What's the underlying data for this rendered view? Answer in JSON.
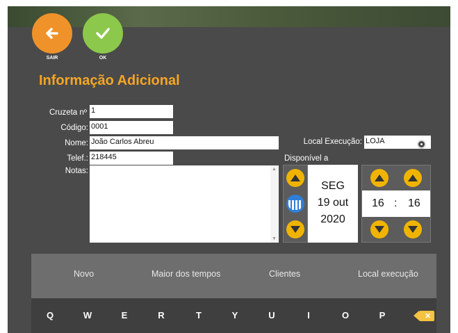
{
  "header": {
    "exit_label": "SAIR",
    "ok_label": "OK",
    "title": "Informação Adicional"
  },
  "form": {
    "cruzeta_label": "Cruzeta nº",
    "cruzeta_value": "1",
    "codigo_label": "Código:",
    "codigo_value": "0001",
    "nome_label": "Nome:",
    "nome_value": "João Carlos Abreu",
    "telef_label": "Telef.:",
    "telef_value": "218445",
    "notas_label": "Notas:",
    "notas_value": "",
    "local_label": "Local Execução:",
    "local_value": "LOJA"
  },
  "availability": {
    "label": "Disponível a",
    "weekday": "SEG",
    "day_month": "19 out",
    "year": "2020",
    "hour": "16",
    "separator": ":",
    "minute": "16"
  },
  "tabs": [
    "Novo",
    "Maior dos tempos",
    "Clientes",
    "Local execução"
  ],
  "keyboard": [
    "Q",
    "W",
    "E",
    "R",
    "T",
    "Y",
    "U",
    "I",
    "O",
    "P"
  ],
  "icons": {
    "exit": "arrow-left-icon",
    "ok": "checkmark-icon",
    "search": "search-icon",
    "calendar": "calendar-icon",
    "backspace": "backspace-icon"
  },
  "colors": {
    "title": "#f5a623",
    "exit_button": "#f0922a",
    "ok_button": "#8cc84b",
    "arrow_buttons": "#f0b400",
    "background": "#4a4a4a"
  }
}
